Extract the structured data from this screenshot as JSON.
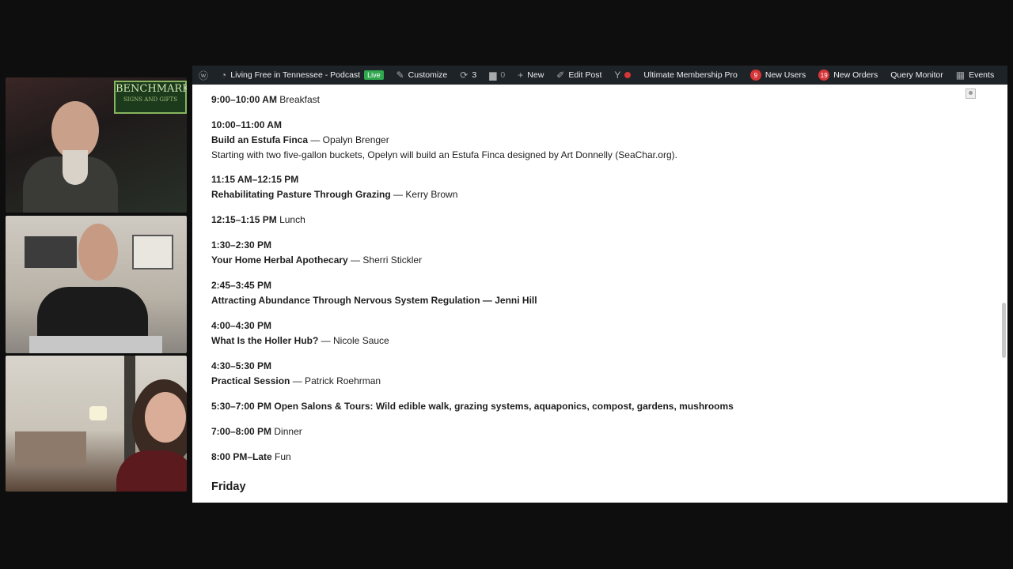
{
  "adminbar": {
    "site_name": "Living Free in Tennessee - Podcast",
    "live_badge": "Live",
    "customize": "Customize",
    "updates_count": "3",
    "comments_count": "0",
    "new": "New",
    "edit_post": "Edit Post",
    "membership": "Ultimate Membership Pro",
    "new_users_count": "9",
    "new_users": "New Users",
    "new_orders_count": "19",
    "new_orders": "New Orders",
    "query_monitor": "Query Monitor",
    "events": "Events"
  },
  "sign": {
    "line1": "BENCHMARK",
    "line2": "SIGNS AND GIFTS"
  },
  "schedule": [
    {
      "time": "9:00–10:00 AM",
      "title_inline": "Breakfast"
    },
    {
      "time": "10:00–11:00 AM",
      "title": "Build an Estufa Finca",
      "presenter": " — Opalyn Brenger",
      "desc": "Starting with two five-gallon buckets, Opelyn will build an Estufa Finca designed by Art Donnelly (SeaChar.org)."
    },
    {
      "time": "11:15 AM–12:15 PM",
      "title": "Rehabilitating Pasture Through Grazing",
      "presenter": " — Kerry Brown"
    },
    {
      "time": "12:15–1:15 PM",
      "title_inline": "Lunch"
    },
    {
      "time": "1:30–2:30 PM",
      "title": "Your Home Herbal Apothecary",
      "presenter": " — Sherri Stickler"
    },
    {
      "time": "2:45–3:45 PM",
      "title": "Attracting Abundance Through Nervous System Regulation — Jenni Hill"
    },
    {
      "time": "4:00–4:30 PM",
      "title": "What Is the Holler Hub?",
      "presenter": " — Nicole Sauce"
    },
    {
      "time": "4:30–5:30 PM",
      "title": "Practical Session",
      "presenter": " — Patrick Roehrman"
    },
    {
      "time": "5:30–7:00 PM Open Salons & Tours: Wild edible walk, grazing systems, aquaponics, compost, gardens, mushrooms"
    },
    {
      "time": "7:00–8:00 PM",
      "title_inline": "Dinner"
    },
    {
      "time": "8:00 PM–Late",
      "title_inline": "Fun"
    }
  ],
  "next_day": "Friday"
}
